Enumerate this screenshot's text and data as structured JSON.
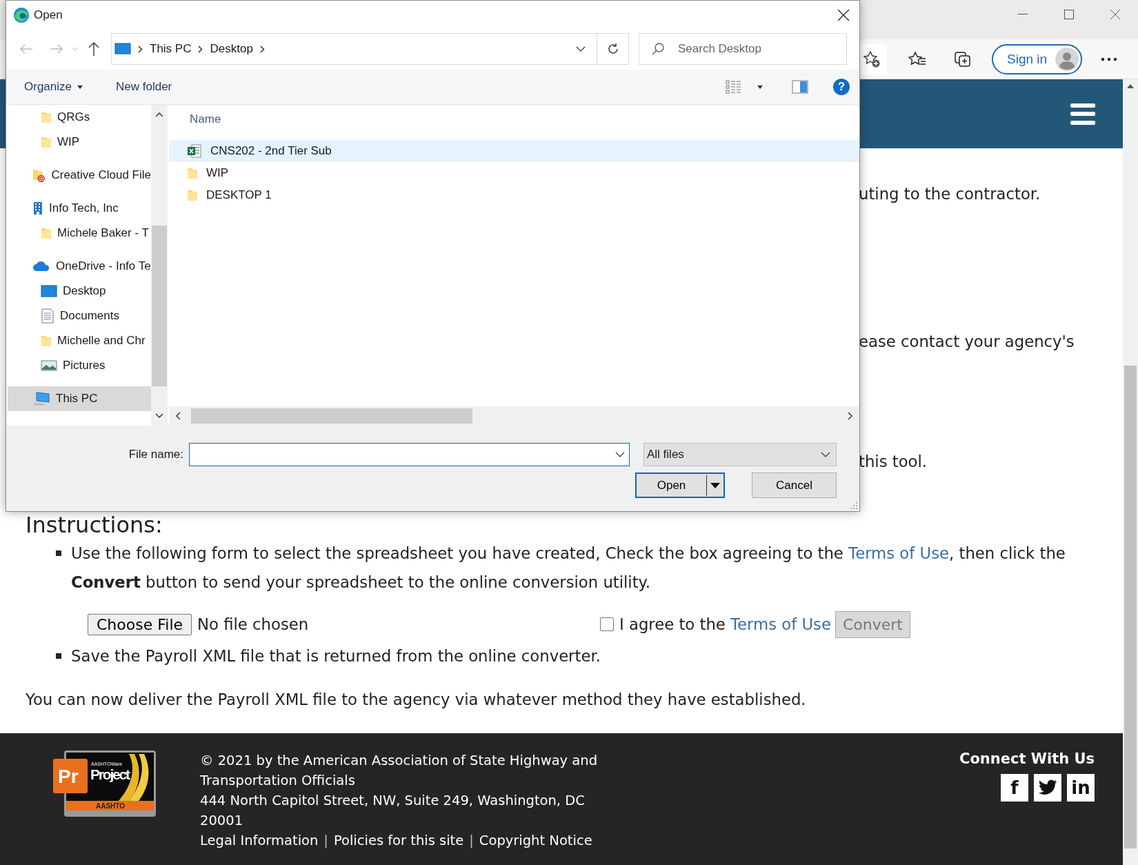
{
  "browser": {
    "sign_in": "Sign in"
  },
  "dialog": {
    "title": "Open",
    "breadcrumb": [
      "This PC",
      "Desktop"
    ],
    "search_placeholder": "Search Desktop",
    "commands": [
      {
        "label": "Organize",
        "dropdown": true
      },
      {
        "label": "New folder",
        "dropdown": false
      }
    ],
    "help_glyph": "?",
    "nav_items": [
      {
        "children": [
          {
            "label": "QRGs",
            "kind": "folder",
            "selected": false
          },
          {
            "label": "WIP",
            "kind": "folder",
            "selected": false
          }
        ]
      },
      {
        "label": "Creative Cloud File",
        "kind": "cc-folder",
        "selected": false
      },
      {
        "label": "Info Tech, Inc",
        "kind": "building",
        "selected": false,
        "children": [
          {
            "label": "Michele Baker - T",
            "kind": "folder",
            "selected": false
          }
        ]
      },
      {
        "label": "OneDrive - Info Te",
        "kind": "cloud",
        "selected": false,
        "children": [
          {
            "label": "Desktop",
            "kind": "desktop",
            "selected": false
          },
          {
            "label": "Documents",
            "kind": "document",
            "selected": false
          },
          {
            "label": "Michelle and Chr",
            "kind": "folder",
            "selected": false
          },
          {
            "label": "Pictures",
            "kind": "pictures",
            "selected": false
          }
        ]
      },
      {
        "label": "This PC",
        "kind": "pc",
        "selected": true
      }
    ],
    "column_header": "Name",
    "files": [
      {
        "name": "CNS202 - 2nd Tier Sub",
        "kind": "spreadsheet",
        "selected": true
      },
      {
        "name": "WIP",
        "kind": "folder",
        "selected": false
      },
      {
        "name": "DESKTOP 1",
        "kind": "folder",
        "selected": false
      }
    ],
    "file_name_label": "File name:",
    "file_type": "All files",
    "buttons": [
      {
        "label": "Open",
        "kind": "split",
        "default": true
      },
      {
        "label": "Cancel",
        "kind": "plain",
        "default": false
      }
    ]
  },
  "page": {
    "fragments": [
      "uting to the contractor.",
      "ease contact your agency's",
      "this tool."
    ],
    "instructions_title": "Instructions:",
    "steps": [
      {
        "kind": "text-link",
        "before": "Use the following form to select the spreadsheet you have created, Check the box agreeing to the ",
        "link": "Terms of Use",
        "after": ", then click the **Convert** button to send your spreadsheet to the online conversion utility."
      },
      {
        "kind": "upload",
        "button": "Choose File",
        "status": "No file chosen",
        "agree_checked": false,
        "agree_text": "I agree to the",
        "agree_link": "Terms of Use",
        "convert": "Convert",
        "convert_disabled": true
      },
      {
        "kind": "text",
        "text": "Save the Payroll XML file that is returned from the online converter."
      }
    ],
    "closing": "You can now deliver the Payroll XML file to the agency via whatever method they have established."
  },
  "footer": {
    "logo": {
      "badge": "Pr",
      "super": "AASHTOWare",
      "name": "Project",
      "org": "AASHTO"
    },
    "copyright": "© 2021 by the American Association of State Highway and Transportation Officials",
    "address": "444 North Capitol Street, NW, Suite 249, Washington, DC 20001",
    "links": [
      {
        "kind": "link",
        "text": "Legal Information"
      },
      {
        "kind": "separator",
        "text": "|"
      },
      {
        "kind": "link",
        "text": "Policies for this site"
      },
      {
        "kind": "separator",
        "text": "|"
      },
      {
        "kind": "link",
        "text": "Copyright Notice"
      }
    ],
    "connect_title": "Connect With Us",
    "social": [
      {
        "kind": "glyph",
        "text": "f"
      },
      {
        "kind": "bird"
      },
      {
        "kind": "glyph",
        "text": "in"
      }
    ]
  }
}
